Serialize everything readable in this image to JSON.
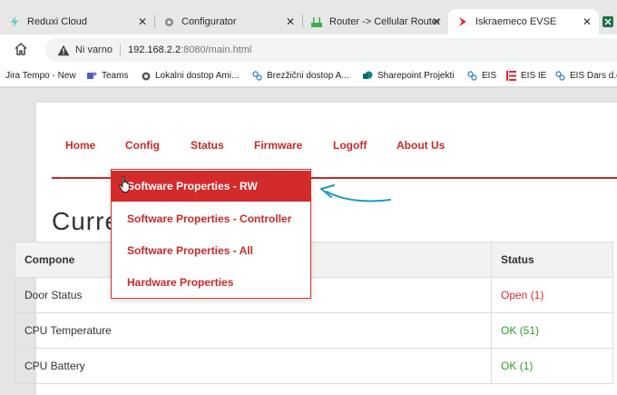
{
  "browser": {
    "tabs": [
      {
        "label": "Reduxi Cloud",
        "icon": "bolt-icon",
        "close": "✕"
      },
      {
        "label": "Configurator",
        "icon": "gear-icon",
        "close": "✕"
      },
      {
        "label": "Router -> Cellular Router",
        "icon": "router-icon",
        "close": "✕"
      },
      {
        "label": "Iskraemeco EVSE",
        "icon": "iskraemeco-icon",
        "close": "✕"
      }
    ],
    "address": {
      "security_label": "Ni varno",
      "host": "192.168.2.2",
      "rest": ":8080/main.html"
    },
    "bookmarks": [
      {
        "label": "Jira Tempo - New"
      },
      {
        "label": "Teams",
        "icon": "teams-icon"
      },
      {
        "label": "Lokalni dostop Ami...",
        "icon": "globe-icon"
      },
      {
        "label": "Brezžični dostop A...",
        "icon": "link-icon"
      },
      {
        "label": "Sharepoint Projekti",
        "icon": "sharepoint-icon"
      },
      {
        "label": "EIS",
        "icon": "link-icon"
      },
      {
        "label": "EIS IE",
        "icon": "iskra-icon"
      },
      {
        "label": "EIS Dars d.d",
        "icon": "link-icon"
      }
    ]
  },
  "nav": {
    "items": [
      "Home",
      "Config",
      "Status",
      "Firmware",
      "Logoff",
      "About Us"
    ]
  },
  "page": {
    "heading": "Curre"
  },
  "dropdown": {
    "items": [
      "Software Properties - RW",
      "Software Properties - Controller",
      "Software Properties - All",
      "Hardware Properties"
    ]
  },
  "table": {
    "headers": [
      "Compone",
      "Status"
    ],
    "rows": [
      {
        "component": "Door Status",
        "status": "Open (1)",
        "status_color": "#d62c2c"
      },
      {
        "component": "CPU Temperature",
        "status": "OK (51)",
        "status_color": "#2e9a2e"
      },
      {
        "component": "CPU Battery",
        "status": "OK (1)",
        "status_color": "#2e9a2e"
      }
    ]
  },
  "colors": {
    "accent": "#c72a2a",
    "highlight": "#d32b2b",
    "annotation": "#1f9bb5"
  }
}
